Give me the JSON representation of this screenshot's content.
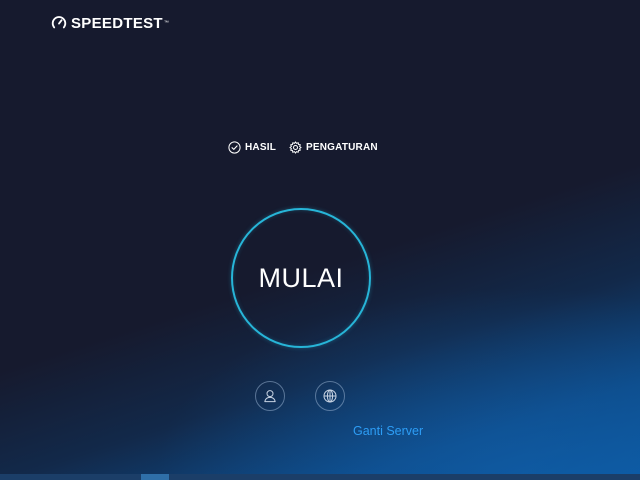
{
  "brand": {
    "name": "SPEEDTEST",
    "trademark": "™",
    "icon": "speedometer-icon"
  },
  "nav": {
    "results_label": "HASIL",
    "results_icon": "check-circle-icon",
    "settings_label": "PENGATURAN",
    "settings_icon": "gear-icon"
  },
  "start": {
    "label": "MULAI",
    "ring_color": "#27b5d8"
  },
  "connection": {
    "user_icon": "user-icon",
    "server_icon": "globe-icon",
    "change_server_label": "Ganti Server",
    "link_color": "#2d9df5"
  },
  "colors": {
    "background_dark": "#161a2e",
    "background_blue": "#0a5aa3"
  }
}
